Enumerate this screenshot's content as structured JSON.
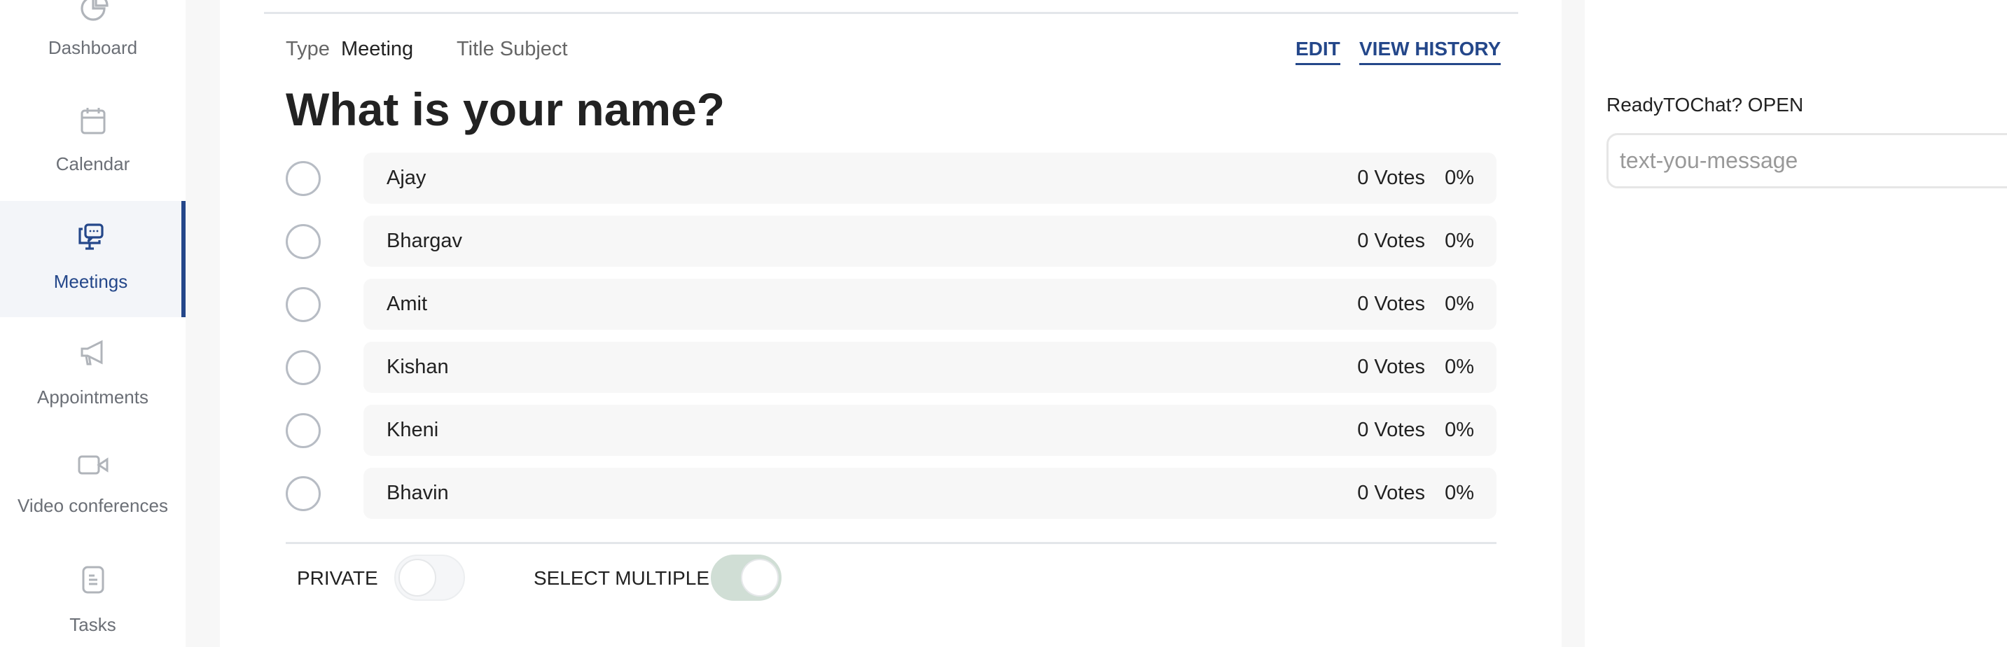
{
  "sidebar": {
    "items": [
      {
        "label": "Dashboard",
        "icon": "pie-chart-icon"
      },
      {
        "label": "Calendar",
        "icon": "calendar-icon"
      },
      {
        "label": "Meetings",
        "icon": "meeting-chat-icon",
        "active": true
      },
      {
        "label": "Appointments",
        "icon": "megaphone-icon"
      },
      {
        "label": "Video conferences",
        "icon": "video-camera-icon"
      },
      {
        "label": "Tasks",
        "icon": "task-list-icon"
      }
    ]
  },
  "poll": {
    "type_label": "Type",
    "type_value": "Meeting",
    "title_label": "Title Subject",
    "edit": "EDIT",
    "view_history": "VIEW HISTORY",
    "question": "What is your name?",
    "options": [
      {
        "name": "Ajay",
        "votes": "0 Votes",
        "percent": "0%"
      },
      {
        "name": "Bhargav",
        "votes": "0 Votes",
        "percent": "0%"
      },
      {
        "name": "Amit",
        "votes": "0 Votes",
        "percent": "0%"
      },
      {
        "name": "Kishan",
        "votes": "0 Votes",
        "percent": "0%"
      },
      {
        "name": "Kheni",
        "votes": "0 Votes",
        "percent": "0%"
      },
      {
        "name": "Bhavin",
        "votes": "0 Votes",
        "percent": "0%"
      }
    ],
    "private_label": "PRIVATE",
    "private_on": false,
    "multiple_label": "SELECT MULTIPLE",
    "multiple_on": true
  },
  "chat": {
    "label": "ReadyTOChat? OPEN",
    "placeholder": "text-you-message"
  },
  "colors": {
    "accent": "#24478a",
    "toggle_on": "#d0ded5"
  }
}
